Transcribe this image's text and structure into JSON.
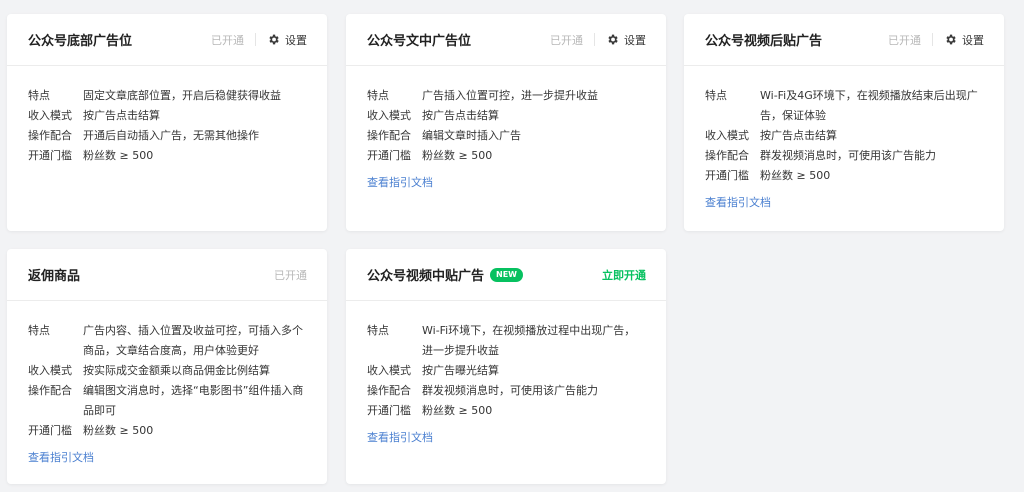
{
  "labels": {
    "feature": "特点",
    "income": "收入模式",
    "operation": "操作配合",
    "threshold": "开通门槛",
    "settings": "设置",
    "guide": "查看指引文档"
  },
  "cards": [
    {
      "title": "公众号底部广告位",
      "status": "已开通",
      "feature": "固定文章底部位置，开启后稳健获得收益",
      "income": "按广告点击结算",
      "operation": "开通后自动插入广告，无需其他操作",
      "threshold": "粉丝数 ≥ 500"
    },
    {
      "title": "公众号文中广告位",
      "status": "已开通",
      "feature": "广告插入位置可控，进一步提升收益",
      "income": "按广告点击结算",
      "operation": "编辑文章时插入广告",
      "threshold": "粉丝数 ≥ 500"
    },
    {
      "title": "公众号视频后贴广告",
      "status": "已开通",
      "feature": "Wi-Fi及4G环境下，在视频播放结束后出现广告，保证体验",
      "income": "按广告点击结算",
      "operation": "群发视频消息时，可使用该广告能力",
      "threshold": "粉丝数 ≥ 500"
    },
    {
      "title": "返佣商品",
      "status": "已开通",
      "feature": "广告内容、插入位置及收益可控，可插入多个商品，文章结合度高，用户体验更好",
      "income": "按实际成交金额乘以商品佣金比例结算",
      "operation": "编辑图文消息时，选择“电影图书”组件插入商品即可",
      "threshold": "粉丝数 ≥ 500"
    },
    {
      "title": "公众号视频中贴广告",
      "badge": "NEW",
      "status": "立即开通",
      "feature": "Wi-Fi环境下，在视频播放过程中出现广告，进一步提升收益",
      "income": "按广告曝光结算",
      "operation": "群发视频消息时，可使用该广告能力",
      "threshold": "粉丝数 ≥ 500"
    }
  ],
  "colors": {
    "accent_green": "#07c160",
    "link_blue": "#4a7fd0",
    "status_gray": "#b8b8b8",
    "background": "#f2f3f5"
  }
}
